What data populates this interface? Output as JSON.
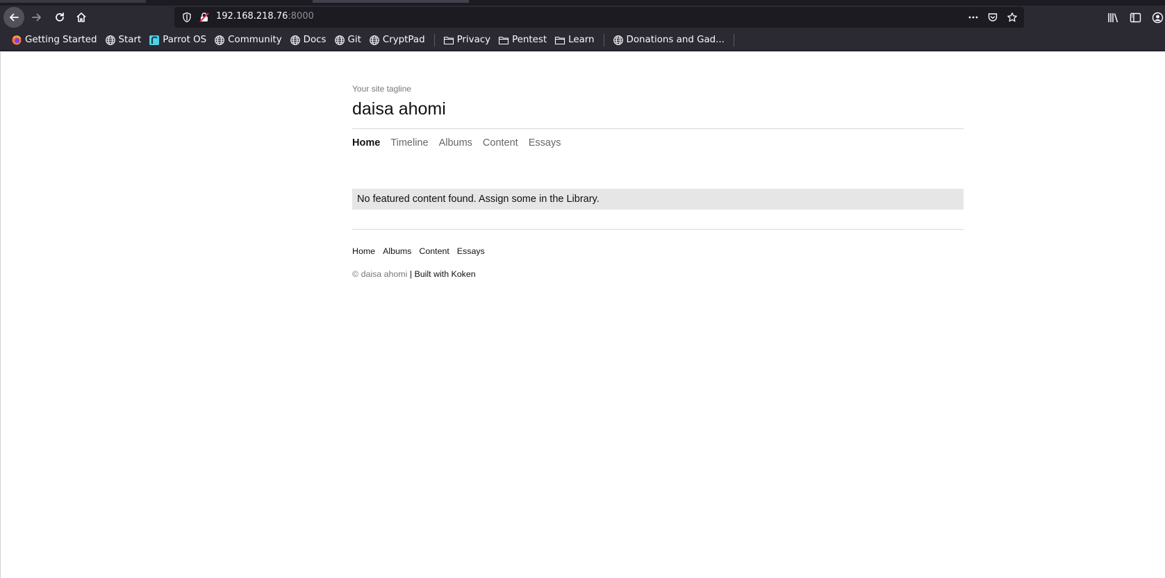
{
  "browser": {
    "url_host": "192.168.218.76",
    "url_port": ":8000",
    "bookmarks": [
      {
        "label": "Getting Started",
        "icon": "firefox-icon"
      },
      {
        "label": "Start",
        "icon": "globe-icon"
      },
      {
        "label": "Parrot OS",
        "icon": "parrot-icon"
      },
      {
        "label": "Community",
        "icon": "globe-icon"
      },
      {
        "label": "Docs",
        "icon": "globe-icon"
      },
      {
        "label": "Git",
        "icon": "globe-icon"
      },
      {
        "label": "CryptPad",
        "icon": "globe-icon"
      },
      {
        "label": "Privacy",
        "icon": "folder-icon"
      },
      {
        "label": "Pentest",
        "icon": "folder-icon"
      },
      {
        "label": "Learn",
        "icon": "folder-icon"
      },
      {
        "label": "Donations and Gad...",
        "icon": "globe-icon"
      }
    ]
  },
  "site": {
    "tagline": "Your site tagline",
    "title": "daisa ahomi",
    "nav": [
      "Home",
      "Timeline",
      "Albums",
      "Content",
      "Essays"
    ],
    "active_nav": "Home",
    "notice": "No featured content found. Assign some in the Library.",
    "footer_nav": [
      "Home",
      "Albums",
      "Content",
      "Essays"
    ],
    "copyright_owner": "© daisa ahomi",
    "copyright_sep": " | ",
    "built_with": "Built with Koken"
  },
  "colors": {
    "chrome_bg": "#2b2a33",
    "urlbar_bg": "#1c1b22",
    "notice_bg": "#e6e6e6"
  }
}
